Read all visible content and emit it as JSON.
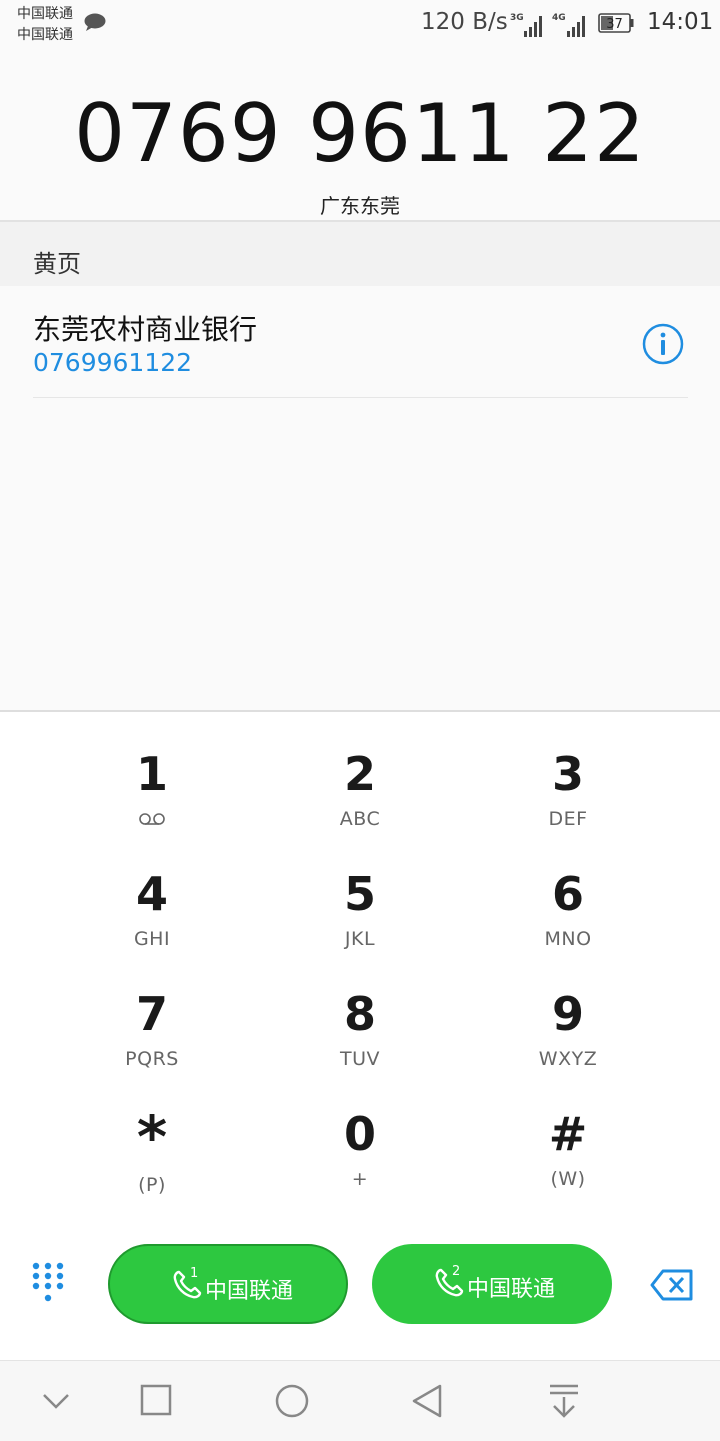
{
  "status_bar": {
    "carrier1": "中国联通",
    "carrier2": "中国联通",
    "net_speed": "120 B/s",
    "sim1_net": "3G",
    "sim2_net": "4G",
    "battery": "37",
    "time": "14:01"
  },
  "dialed": {
    "number": "0769 9611 22",
    "location": "广东东莞"
  },
  "yellow_pages": {
    "header": "黄页",
    "result_name": "东莞农村商业银行",
    "result_number": "0769961122"
  },
  "keypad": [
    {
      "digit": "1",
      "letters": ""
    },
    {
      "digit": "2",
      "letters": "ABC"
    },
    {
      "digit": "3",
      "letters": "DEF"
    },
    {
      "digit": "4",
      "letters": "GHI"
    },
    {
      "digit": "5",
      "letters": "JKL"
    },
    {
      "digit": "6",
      "letters": "MNO"
    },
    {
      "digit": "7",
      "letters": "PQRS"
    },
    {
      "digit": "8",
      "letters": "TUV"
    },
    {
      "digit": "9",
      "letters": "WXYZ"
    },
    {
      "digit": "*",
      "letters": "(P)"
    },
    {
      "digit": "0",
      "letters": "+"
    },
    {
      "digit": "#",
      "letters": "(W)"
    }
  ],
  "call_buttons": {
    "sim1_index": "1",
    "sim1_label": "中国联通",
    "sim2_index": "2",
    "sim2_label": "中国联通"
  },
  "icons": [
    "message-icon",
    "voicemail-icon",
    "info-icon",
    "dialpad-toggle-icon",
    "phone-icon",
    "backspace-icon",
    "nav-collapse-icon",
    "nav-recents-icon",
    "nav-home-icon",
    "nav-back-icon",
    "nav-notifications-icon"
  ],
  "colors": {
    "accent_blue": "#1f8de0",
    "call_green": "#2dc840"
  }
}
